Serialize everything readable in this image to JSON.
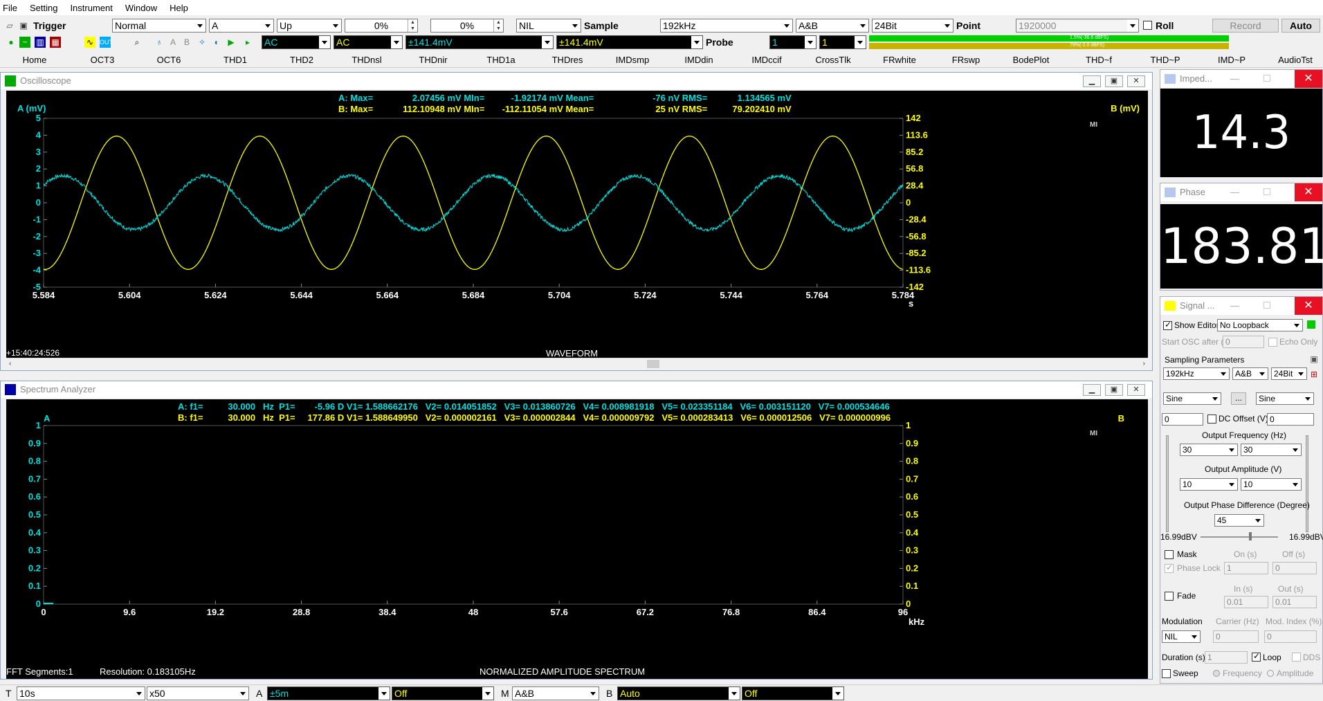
{
  "menu": [
    "File",
    "Setting",
    "Instrument",
    "Window",
    "Help"
  ],
  "toolbar1": {
    "trigger_label": "Trigger",
    "mode": "Normal",
    "channel": "A",
    "edge": "Up",
    "level1": "0%",
    "level2": "0%",
    "nil": "NIL",
    "sample_label": "Sample",
    "sample_rate": "192kHz",
    "channels": "A&B",
    "bits": "24Bit",
    "point_label": "Point",
    "point_value": "1920000",
    "roll_label": "Roll",
    "record_label": "Record",
    "auto_label": "Auto"
  },
  "toolbar2": {
    "coupling_a": "AC",
    "coupling_b": "AC",
    "range_a": "±141.4mV",
    "range_b": "±141.4mV",
    "probe_label": "Probe",
    "probe_a": "1",
    "probe_b": "1",
    "meter_a": "1.5%(-36.6 dBFS)",
    "meter_b": "79%(-2.0 dBFS)"
  },
  "tabs": [
    "Home",
    "OCT3",
    "OCT6",
    "THD1",
    "THD2",
    "THDnsl",
    "THDnir",
    "THD1a",
    "THDres",
    "IMDsmp",
    "IMDdin",
    "IMDccif",
    "CrossTlk",
    "FRwhite",
    "FRswp",
    "BodePlot",
    "THD~f",
    "THD~P",
    "IMD~P",
    "AudioTst"
  ],
  "oscilloscope": {
    "title": "Oscilloscope",
    "stats_a": {
      "prefix": "A:",
      "max_label": "Max=",
      "max": "2.07456",
      "max_unit": "mV",
      "min_label": "MIn=",
      "min": "-1.92174",
      "min_unit": "mV",
      "mean_label": "Mean=",
      "mean": "-76",
      "mean_unit": "nV",
      "rms_label": "RMS=",
      "rms": "1.134565",
      "rms_unit": "mV"
    },
    "stats_b": {
      "prefix": "B:",
      "max_label": "Max=",
      "max": "112.10948",
      "max_unit": "mV",
      "min_label": "MIn=",
      "min": "-112.11054",
      "min_unit": "mV",
      "mean_label": "Mean=",
      "mean": "25",
      "mean_unit": "nV",
      "rms_label": "RMS=",
      "rms": "79.202410",
      "rms_unit": "mV"
    },
    "left_axis_label": "A (mV)",
    "right_axis_label": "B (mV)",
    "left_ticks": [
      "5",
      "4",
      "3",
      "2",
      "1",
      "0",
      "-1",
      "-2",
      "-3",
      "-4",
      "-5"
    ],
    "right_ticks": [
      "142",
      "113.6",
      "85.2",
      "56.8",
      "28.4",
      "0",
      "-28.4",
      "-56.8",
      "-85.2",
      "-113.6",
      "-142"
    ],
    "x_ticks": [
      "5.584",
      "5.604",
      "5.624",
      "5.644",
      "5.664",
      "5.684",
      "5.704",
      "5.724",
      "5.744",
      "5.764",
      "5.784"
    ],
    "x_unit": "s",
    "timestamp": "+15:40:24:526",
    "caption": "WAVEFORM",
    "badge": "MI"
  },
  "chart_data": [
    {
      "type": "line",
      "title": "WAVEFORM",
      "xlabel": "s",
      "ylabel": "A (mV)",
      "y2label": "B (mV)",
      "xlim": [
        5.584,
        5.784
      ],
      "ylim": [
        -5,
        5
      ],
      "y2lim": [
        -142,
        142
      ],
      "series": [
        {
          "name": "A",
          "color": "#00e0e0",
          "frequency_hz": 30,
          "amplitude": 1.6,
          "phase_deg": 180,
          "axis": "left"
        },
        {
          "name": "B",
          "color": "#ffff00",
          "frequency_hz": 30,
          "amplitude": 112.1,
          "phase_deg": 45,
          "axis": "right"
        }
      ]
    },
    {
      "type": "line",
      "title": "NORMALIZED AMPLITUDE SPECTRUM",
      "xlabel": "kHz",
      "ylabel": "A",
      "y2label": "B",
      "xlim": [
        0,
        96
      ],
      "ylim": [
        0,
        1
      ],
      "series": []
    }
  ],
  "spectrum": {
    "title": "Spectrum Analyzer",
    "line_a": {
      "prefix": "A: f1=",
      "f1": "30.000",
      "hz": "Hz",
      "p1": "P1=",
      "p1v": "-5.96",
      "d": "D",
      "v1": "V1= 1.588662176",
      "v2": "V2= 0.014051852",
      "v3": "V3= 0.013860726",
      "v4": "V4= 0.008981918",
      "v5": "V5= 0.023351184",
      "v6": "V6= 0.003151120",
      "v7": "V7= 0.000534646"
    },
    "line_b": {
      "prefix": "B: f1=",
      "f1": "30.000",
      "hz": "Hz",
      "p1": "P1=",
      "p1v": "177.86",
      "d": "D",
      "v1": "V1= 1.588649950",
      "v2": "V2= 0.000002161",
      "v3": "V3= 0.000002844",
      "v4": "V4= 0.000009792",
      "v5": "V5= 0.000283413",
      "v6": "V6= 0.000012506",
      "v7": "V7= 0.000000996"
    },
    "left_axis_label": "A",
    "right_axis_label": "B",
    "y_ticks": [
      "1",
      "0.9",
      "0.8",
      "0.7",
      "0.6",
      "0.5",
      "0.4",
      "0.3",
      "0.2",
      "0.1",
      "0"
    ],
    "x_ticks": [
      "0",
      "9.6",
      "19.2",
      "28.8",
      "38.4",
      "48",
      "57.6",
      "67.2",
      "76.8",
      "86.4",
      "96"
    ],
    "x_unit": "kHz",
    "caption": "NORMALIZED AMPLITUDE SPECTRUM",
    "fft_segments": "FFT Segments:1",
    "resolution": "Resolution: 0.183105Hz",
    "badge": "MI"
  },
  "impedance": {
    "title": "Imped...",
    "value": "14.3 mOhms"
  },
  "phase": {
    "title": "Phase",
    "value": "183.81",
    "unit": "°"
  },
  "signal": {
    "title": "Signal ...",
    "show_editor": "Show Editor",
    "loopback": "No Loopback",
    "start_osc": "Start OSC after (s)",
    "start_osc_val": "0",
    "echo_only": "Echo Only",
    "sampling_params": "Sampling Parameters",
    "rate": "192kHz",
    "channels": "A&B",
    "bits": "24Bit",
    "wave_a": "Sine",
    "wave_b": "Sine",
    "more": "...",
    "dc_a": "0",
    "dc_label": "DC Offset (V)",
    "dc_b": "0",
    "freq_label": "Output Frequency (Hz)",
    "freq_a": "30",
    "freq_b": "30",
    "amp_label": "Output Amplitude (V)",
    "amp_a": "10",
    "amp_b": "10",
    "phase_label": "Output Phase Difference (Degree)",
    "phase_val": "45",
    "level_a": "16.99dBV",
    "level_b": "16.99dBV",
    "mask": "Mask",
    "on_label": "On (s)",
    "off_label": "Off (s)",
    "phase_lock": "Phase Lock",
    "on_val": "1",
    "off_val": "0",
    "fade": "Fade",
    "in_label": "In (s)",
    "out_label": "Out (s)",
    "in_val": "0.01",
    "out_val": "0.01",
    "modulation": "Modulation",
    "carrier_label": "Carrier (Hz)",
    "mod_index_label": "Mod. Index (%)",
    "mod_val": "NIL",
    "carrier_val": "0",
    "mod_index_val": "0",
    "duration_label": "Duration (s)",
    "duration_val": "1",
    "loop": "Loop",
    "dds": "DDS",
    "sweep": "Sweep",
    "frequency": "Frequency",
    "amplitude": "Amplitude"
  },
  "statusbar": {
    "t_label": "T",
    "t_val": "10s",
    "zoom": "x50",
    "a_label": "A",
    "a_val": "±5m",
    "a_off": "Off",
    "m_label": "M",
    "m_val": "A&B",
    "b_label": "B",
    "b_val": "Auto",
    "b_off": "Off"
  }
}
